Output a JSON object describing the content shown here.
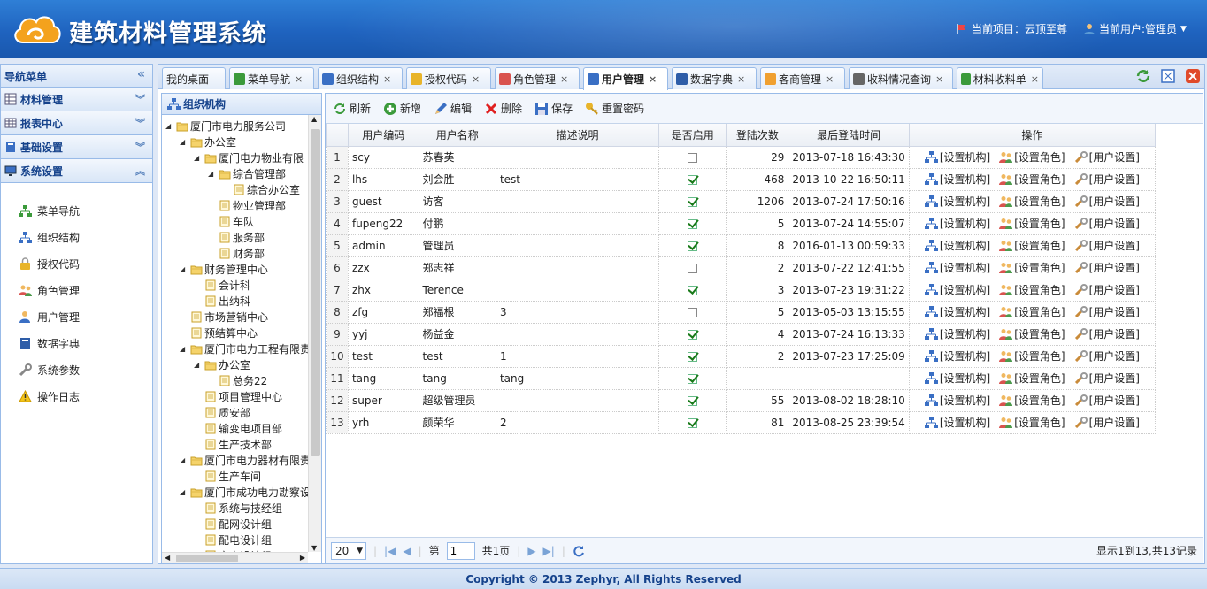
{
  "header": {
    "app_title": "建筑材料管理系统",
    "project": "当前项目：云顶至尊",
    "user": "当前用户:管理员"
  },
  "sidebar": {
    "title": "导航菜单",
    "sections": [
      "材料管理",
      "报表中心",
      "基础设置",
      "系统设置"
    ],
    "items": [
      {
        "label": "菜单导航",
        "icon": "sitemap-icon"
      },
      {
        "label": "组织结构",
        "icon": "org-chart-icon"
      },
      {
        "label": "授权代码",
        "icon": "lock-icon"
      },
      {
        "label": "角色管理",
        "icon": "users-icon"
      },
      {
        "label": "用户管理",
        "icon": "user-icon"
      },
      {
        "label": "数据字典",
        "icon": "book-icon"
      },
      {
        "label": "系统参数",
        "icon": "wrench-icon"
      },
      {
        "label": "操作日志",
        "icon": "warning-icon"
      }
    ]
  },
  "tabs": [
    {
      "label": "我的桌面",
      "closable": false
    },
    {
      "label": "菜单导航",
      "closable": true
    },
    {
      "label": "组织结构",
      "closable": true
    },
    {
      "label": "授权代码",
      "closable": true
    },
    {
      "label": "角色管理",
      "closable": true
    },
    {
      "label": "用户管理",
      "closable": true,
      "active": true
    },
    {
      "label": "数据字典",
      "closable": true
    },
    {
      "label": "客商管理",
      "closable": true
    },
    {
      "label": "收料情况查询",
      "closable": true
    },
    {
      "label": "材料收料单",
      "closable": true
    }
  ],
  "org": {
    "title": "组织机构",
    "nodes": [
      {
        "label": "厦门市电力服务公司",
        "level": 0,
        "type": "folder",
        "open": true
      },
      {
        "label": "办公室",
        "level": 1,
        "type": "folder",
        "open": true
      },
      {
        "label": "厦门电力物业有限",
        "level": 2,
        "type": "folder",
        "open": true
      },
      {
        "label": "综合管理部",
        "level": 3,
        "type": "folder",
        "open": true
      },
      {
        "label": "综合办公室",
        "level": 4,
        "type": "file"
      },
      {
        "label": "物业管理部",
        "level": 3,
        "type": "file"
      },
      {
        "label": "车队",
        "level": 3,
        "type": "file"
      },
      {
        "label": "服务部",
        "level": 3,
        "type": "file"
      },
      {
        "label": "财务部",
        "level": 3,
        "type": "file"
      },
      {
        "label": "财务管理中心",
        "level": 1,
        "type": "folder",
        "open": true
      },
      {
        "label": "会计科",
        "level": 2,
        "type": "file"
      },
      {
        "label": "出纳科",
        "level": 2,
        "type": "file"
      },
      {
        "label": "市场营销中心",
        "level": 1,
        "type": "file"
      },
      {
        "label": "预结算中心",
        "level": 1,
        "type": "file"
      },
      {
        "label": "厦门市电力工程有限责",
        "level": 1,
        "type": "folder",
        "open": true
      },
      {
        "label": "办公室",
        "level": 2,
        "type": "folder",
        "open": true
      },
      {
        "label": "总务22",
        "level": 3,
        "type": "file"
      },
      {
        "label": "项目管理中心",
        "level": 2,
        "type": "file"
      },
      {
        "label": "质安部",
        "level": 2,
        "type": "file"
      },
      {
        "label": "输变电项目部",
        "level": 2,
        "type": "file"
      },
      {
        "label": "生产技术部",
        "level": 2,
        "type": "file"
      },
      {
        "label": "厦门市电力器材有限责",
        "level": 1,
        "type": "folder",
        "open": true
      },
      {
        "label": "生产车间",
        "level": 2,
        "type": "file"
      },
      {
        "label": "厦门市成功电力勘察设",
        "level": 1,
        "type": "folder",
        "open": true
      },
      {
        "label": "系统与技经组",
        "level": 2,
        "type": "file"
      },
      {
        "label": "配网设计组",
        "level": 2,
        "type": "file"
      },
      {
        "label": "配电设计组",
        "level": 2,
        "type": "file"
      },
      {
        "label": "变电设计组",
        "level": 2,
        "type": "file"
      }
    ]
  },
  "toolbar": {
    "refresh": "刷新",
    "add": "新增",
    "edit": "编辑",
    "delete": "删除",
    "save": "保存",
    "reset_pwd": "重置密码"
  },
  "table": {
    "columns": [
      "用户编码",
      "用户名称",
      "描述说明",
      "是否启用",
      "登陆次数",
      "最后登陆时间",
      "操作"
    ],
    "actions": [
      "[设置机构]",
      "[设置角色]",
      "[用户设置]"
    ],
    "rows": [
      {
        "n": "1",
        "code": "scy",
        "name": "苏春英",
        "desc": "",
        "enabled": false,
        "logins": "29",
        "last": "2013-07-18 16:43:30"
      },
      {
        "n": "2",
        "code": "lhs",
        "name": "刘会胜",
        "desc": "test",
        "enabled": true,
        "logins": "468",
        "last": "2013-10-22 16:50:11"
      },
      {
        "n": "3",
        "code": "guest",
        "name": "访客",
        "desc": "",
        "enabled": true,
        "logins": "1206",
        "last": "2013-07-24 17:50:16"
      },
      {
        "n": "4",
        "code": "fupeng22",
        "name": "付鹏",
        "desc": "",
        "enabled": true,
        "logins": "5",
        "last": "2013-07-24 14:55:07"
      },
      {
        "n": "5",
        "code": "admin",
        "name": "管理员",
        "desc": "",
        "enabled": true,
        "logins": "8",
        "last": "2016-01-13 00:59:33"
      },
      {
        "n": "6",
        "code": "zzx",
        "name": "郑志祥",
        "desc": "",
        "enabled": false,
        "logins": "2",
        "last": "2013-07-22 12:41:55"
      },
      {
        "n": "7",
        "code": "zhx",
        "name": "Terence",
        "desc": "",
        "enabled": true,
        "logins": "3",
        "last": "2013-07-23 19:31:22"
      },
      {
        "n": "8",
        "code": "zfg",
        "name": "郑福根",
        "desc": "3",
        "enabled": false,
        "logins": "5",
        "last": "2013-05-03 13:15:55"
      },
      {
        "n": "9",
        "code": "yyj",
        "name": "杨益金",
        "desc": "",
        "enabled": true,
        "logins": "4",
        "last": "2013-07-24 16:13:33"
      },
      {
        "n": "10",
        "code": "test",
        "name": "test",
        "desc": "1",
        "enabled": true,
        "logins": "2",
        "last": "2013-07-23 17:25:09"
      },
      {
        "n": "11",
        "code": "tang",
        "name": "tang",
        "desc": "tang",
        "enabled": true,
        "logins": "",
        "last": ""
      },
      {
        "n": "12",
        "code": "super",
        "name": "超级管理员",
        "desc": "",
        "enabled": true,
        "logins": "55",
        "last": "2013-08-02 18:28:10"
      },
      {
        "n": "13",
        "code": "yrh",
        "name": "颜荣华",
        "desc": "2",
        "enabled": true,
        "logins": "81",
        "last": "2013-08-25 23:39:54"
      }
    ]
  },
  "pager": {
    "page_size": "20",
    "page_prefix": "第",
    "page_value": "1",
    "page_suffix": "共1页",
    "info": "显示1到13,共13记录"
  },
  "footer": "Copyright © 2013 Zephyr, All Rights Reserved"
}
